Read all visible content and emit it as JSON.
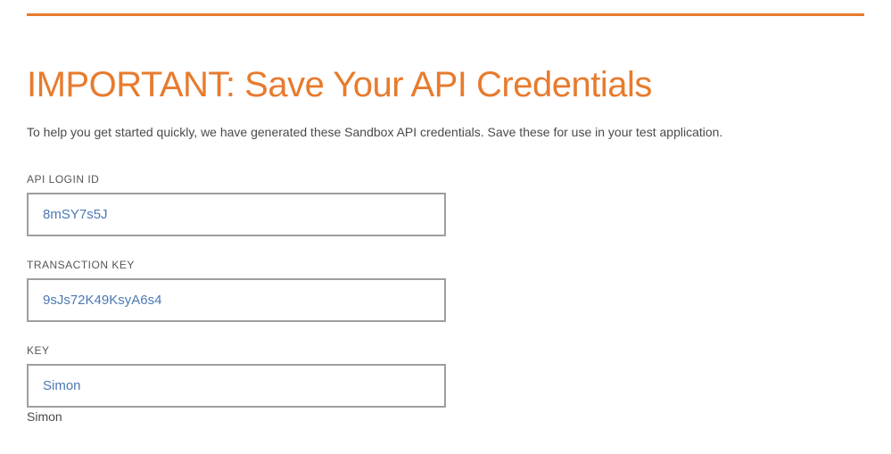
{
  "heading": "IMPORTANT: Save Your API Credentials",
  "intro": "To help you get started quickly, we have generated these Sandbox API credentials. Save these for use in your test application.",
  "fields": {
    "api_login_id": {
      "label": "API LOGIN ID",
      "value": "8mSY7s5J"
    },
    "transaction_key": {
      "label": "TRANSACTION KEY",
      "value": "9sJs72K49KsyA6s4"
    },
    "key": {
      "label": "KEY",
      "value": "Simon"
    }
  },
  "trailing": "Simon"
}
